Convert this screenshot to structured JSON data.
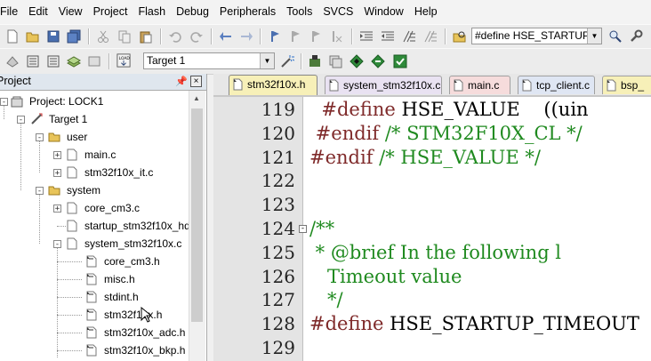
{
  "menu": [
    "File",
    "Edit",
    "View",
    "Project",
    "Flash",
    "Debug",
    "Peripherals",
    "Tools",
    "SVCS",
    "Window",
    "Help"
  ],
  "toolbar": {
    "find_combo_value": "#define HSE_STARTUP_TI",
    "target_combo_value": "Target 1"
  },
  "project_panel": {
    "title": "Project",
    "pin_glyph": "ᵖ",
    "close_glyph": "×",
    "tree": [
      {
        "label": "Project: LOCK1",
        "icon": "project-icon"
      },
      {
        "label": "Target 1",
        "icon": "target-icon"
      },
      {
        "label": "user",
        "icon": "folder-icon"
      },
      {
        "label": "main.c",
        "icon": "c-file-icon"
      },
      {
        "label": "stm32f10x_it.c",
        "icon": "c-file-icon"
      },
      {
        "label": "system",
        "icon": "folder-icon"
      },
      {
        "label": "core_cm3.c",
        "icon": "c-file-icon"
      },
      {
        "label": "startup_stm32f10x_hd",
        "icon": "asm-file-icon"
      },
      {
        "label": "system_stm32f10x.c",
        "icon": "c-file-icon"
      },
      {
        "label": "core_cm3.h",
        "icon": "h-file-icon"
      },
      {
        "label": "misc.h",
        "icon": "h-file-icon"
      },
      {
        "label": "stdint.h",
        "icon": "h-file-icon"
      },
      {
        "label": "stm32f10x.h",
        "icon": "h-file-icon"
      },
      {
        "label": "stm32f10x_adc.h",
        "icon": "h-file-icon"
      },
      {
        "label": "stm32f10x_bkp.h",
        "icon": "h-file-icon"
      }
    ]
  },
  "tabs": [
    {
      "label": "stm32f10x.h",
      "color": "#f7f0b8",
      "active": true
    },
    {
      "label": "system_stm32f10x.c",
      "color": "#e9e2f2",
      "active": false
    },
    {
      "label": "main.c",
      "color": "#f6dcdc",
      "active": false
    },
    {
      "label": "tcp_client.c",
      "color": "#dfe6f3",
      "active": false
    },
    {
      "label": "bsp_",
      "color": "#f7f0b8",
      "active": false
    }
  ],
  "editor": {
    "lines": [
      {
        "num": "119",
        "parts": [
          {
            "t": "  #define ",
            "c": "pre"
          },
          {
            "t": "HSE_VALUE    ((uin",
            "c": "plain"
          }
        ]
      },
      {
        "num": "120",
        "parts": [
          {
            "t": " #endif ",
            "c": "pre"
          },
          {
            "t": "/* STM32F10X_CL */",
            "c": "cm"
          }
        ]
      },
      {
        "num": "121",
        "parts": [
          {
            "t": "#endif ",
            "c": "pre"
          },
          {
            "t": "/* HSE_VALUE */",
            "c": "cm"
          }
        ]
      },
      {
        "num": "122",
        "parts": []
      },
      {
        "num": "123",
        "parts": []
      },
      {
        "num": "124",
        "parts": [
          {
            "t": "/**",
            "c": "cm"
          }
        ]
      },
      {
        "num": "125",
        "parts": [
          {
            "t": " * @brief In the following l",
            "c": "cm"
          }
        ]
      },
      {
        "num": "126",
        "parts": [
          {
            "t": "   Timeout value",
            "c": "cm"
          }
        ]
      },
      {
        "num": "127",
        "parts": [
          {
            "t": "   */",
            "c": "cm"
          }
        ]
      },
      {
        "num": "128",
        "parts": [
          {
            "t": "#define ",
            "c": "pre"
          },
          {
            "t": "HSE_STARTUP_TIMEOUT",
            "c": "plain"
          }
        ]
      },
      {
        "num": "129",
        "parts": []
      }
    ]
  },
  "colors": {
    "preprocessor": "#7f2a2a",
    "comment": "#1f8a1f"
  }
}
